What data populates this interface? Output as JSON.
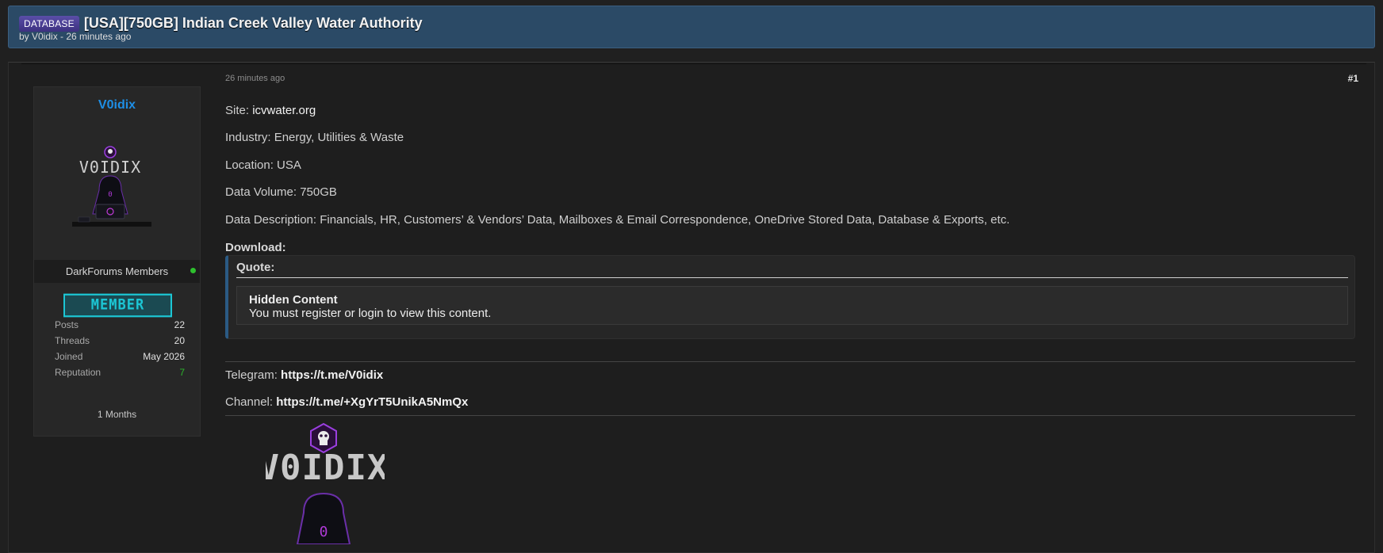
{
  "thread": {
    "prefix": "DATABASE",
    "title": "[USA][750GB] Indian Creek Valley Water Authority",
    "meta": "by V0idix - 26 minutes ago"
  },
  "author": {
    "username": "V0idix",
    "avatar_text": "V0IDIX",
    "group": "DarkForums Members",
    "userbar": "MEMBER",
    "stats": [
      {
        "label": "Posts",
        "value": "22"
      },
      {
        "label": "Threads",
        "value": "20"
      },
      {
        "label": "Joined",
        "value": "May 2026"
      },
      {
        "label": "Reputation",
        "value": "7"
      }
    ],
    "tenure": "1 Months"
  },
  "post": {
    "date": "26 minutes ago",
    "number": "#1",
    "site_label": "Site: ",
    "site_value": "icvwater.org",
    "industry": "Industry: Energy, Utilities & Waste",
    "location": "Location: USA",
    "volume": "Data Volume: 750GB",
    "description": "Data Description: Financials, HR, Customers’ & Vendors’ Data, Mailboxes & Email Correspondence, OneDrive Stored Data, Database & Exports, etc.",
    "download_label": "Download:",
    "quote_label": "Quote:",
    "hidden_title": "Hidden Content",
    "hidden_text": "You must register or login to view this content.",
    "telegram_label": "Telegram: ",
    "telegram_link": "https://t.me/V0idix",
    "channel_label": "Channel: ",
    "channel_link": "https://t.me/+XgYrT5UnikA5NmQx"
  },
  "signature": {
    "logo_text": "V0IDIX",
    "icon": "hooded-skull-logo-icon"
  },
  "colors": {
    "header_bg": "#2b4a66",
    "username": "#1e8fe6",
    "userbar": "#1cc6d4",
    "reputation": "#2bb52b",
    "accent_purple": "#8a2be2"
  }
}
